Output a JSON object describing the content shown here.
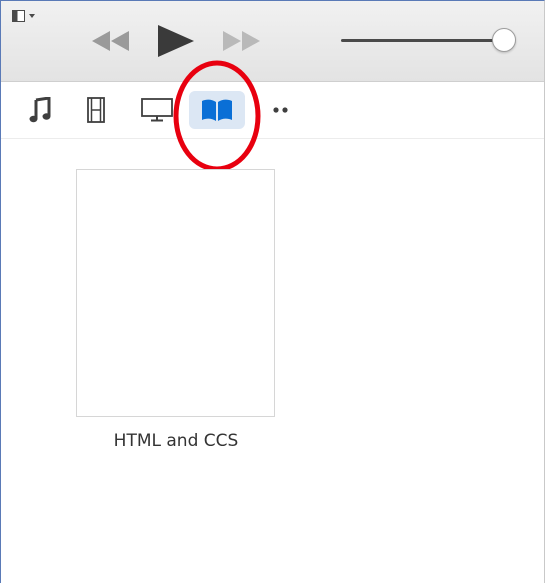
{
  "toolbar": {
    "sidebar_toggle_icon": "sidebar-toggle-icon",
    "transport": {
      "previous_icon": "rewind-icon",
      "play_icon": "play-icon",
      "next_icon": "fast-forward-icon"
    },
    "volume": {
      "level": 0.95
    }
  },
  "media_kinds": [
    {
      "name": "music",
      "icon": "music-note-icon",
      "selected": false
    },
    {
      "name": "movies",
      "icon": "film-icon",
      "selected": false
    },
    {
      "name": "tv-shows",
      "icon": "tv-icon",
      "selected": false
    },
    {
      "name": "books",
      "icon": "book-icon",
      "selected": true
    },
    {
      "name": "more",
      "icon": "more-icon",
      "selected": false
    }
  ],
  "annotation": {
    "color": "#e8000f"
  },
  "library": {
    "items": [
      {
        "title": "HTML and CCS"
      }
    ]
  },
  "colors": {
    "accent": "#0a6fd6",
    "selected_bg": "#dce7f4",
    "icon_gray": "#3f3f3f",
    "transport_gray": "#9a9a9a"
  }
}
